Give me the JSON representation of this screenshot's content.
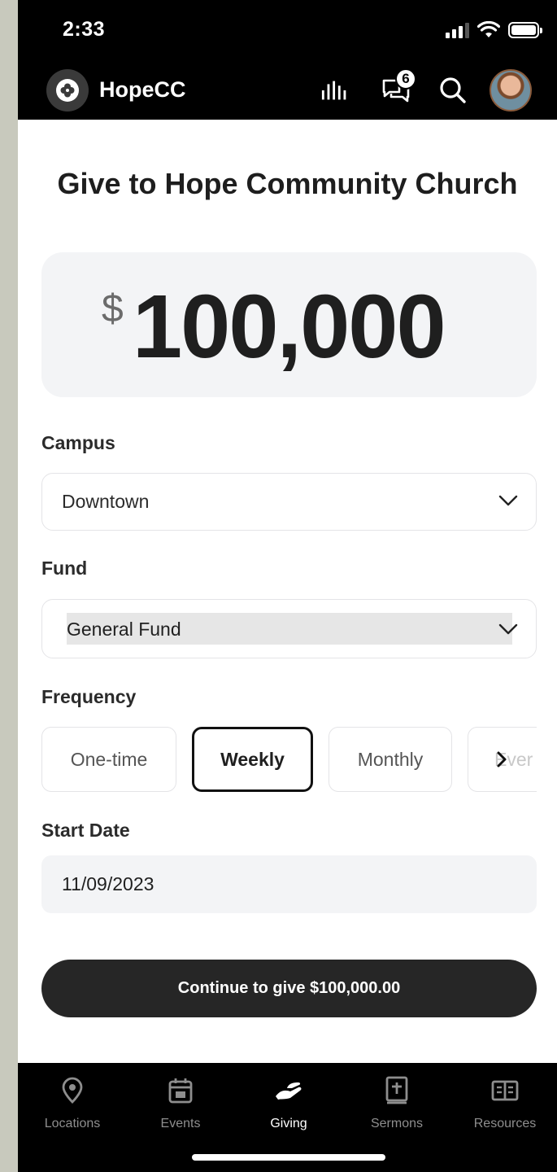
{
  "status": {
    "time": "2:33"
  },
  "header": {
    "app_name": "HopeCC",
    "notification_count": "6"
  },
  "page": {
    "title": "Give to Hope Community Church"
  },
  "amount": {
    "currency": "$",
    "value": "100,000"
  },
  "campus": {
    "label": "Campus",
    "value": "Downtown"
  },
  "fund": {
    "label": "Fund",
    "value": "General Fund"
  },
  "frequency": {
    "label": "Frequency",
    "options": [
      "One-time",
      "Weekly",
      "Monthly",
      "Ever"
    ],
    "selected": "Weekly"
  },
  "start_date": {
    "label": "Start Date",
    "value": "11/09/2023"
  },
  "continue_label": "Continue to give $100,000.00",
  "tabs": [
    {
      "label": "Locations",
      "icon": "map-pin-icon"
    },
    {
      "label": "Events",
      "icon": "calendar-icon"
    },
    {
      "label": "Giving",
      "icon": "giving-hand-icon"
    },
    {
      "label": "Sermons",
      "icon": "bible-icon"
    },
    {
      "label": "Resources",
      "icon": "book-open-icon"
    }
  ],
  "active_tab": "Giving",
  "colors": {
    "accent_dark": "#262626",
    "surface_gray": "#f3f4f6",
    "bar_black": "#000000"
  }
}
